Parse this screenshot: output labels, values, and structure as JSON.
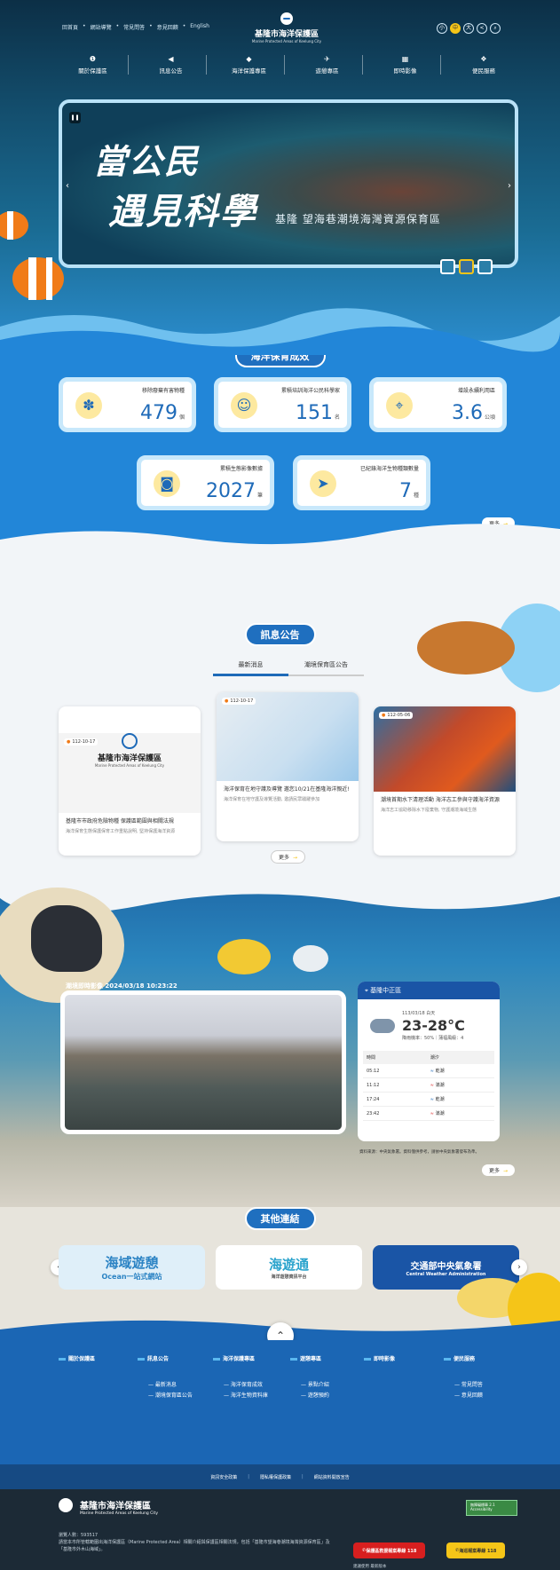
{
  "header": {
    "top_links": [
      "回首頁",
      "網站導覽",
      "常見問答",
      "意見回饋",
      "English"
    ],
    "logo_zh": "基隆市海洋保護區",
    "logo_en": "Marine Protected Areas of Keelung City",
    "util_icons": [
      "font-small-icon",
      "font-medium-icon",
      "font-large-icon",
      "share-icon",
      "search-icon"
    ],
    "util_glyphs": [
      "小",
      "中",
      "大",
      "<",
      "⌕"
    ],
    "nav": [
      "關於保護區",
      "訊息公告",
      "海洋保護專區",
      "遊憩專區",
      "即時影像",
      "便民服務"
    ],
    "nav_icons": [
      "info-icon",
      "megaphone-icon",
      "shield-icon",
      "boat-icon",
      "camera-icon",
      "service-icon"
    ],
    "nav_glyphs": [
      "❶",
      "◀",
      "◆",
      "✈",
      "▦",
      "❖"
    ]
  },
  "banner": {
    "line1": "當公民",
    "line2": "遇見科學",
    "tagline": "基隆 望海巷潮境海灣資源保育區"
  },
  "stats": {
    "title": "海洋保育成效",
    "items": [
      {
        "label": "移除廢棄有害物種",
        "value": "479",
        "unit": "個",
        "icon": "coral-icon"
      },
      {
        "label": "累積培訓海洋公民科學家",
        "value": "151",
        "unit": "名",
        "icon": "diver-icon"
      },
      {
        "label": "增設永續利用區",
        "value": "3.6",
        "unit": "公頃",
        "icon": "map-pin-icon"
      },
      {
        "label": "累積生態影像數據",
        "value": "2027",
        "unit": "筆",
        "icon": "camera-icon"
      },
      {
        "label": "已紀錄海洋生物種類數量",
        "value": "7",
        "unit": "種",
        "icon": "fish-icon"
      }
    ],
    "more": "更多"
  },
  "news": {
    "title": "訊息公告",
    "tabs": [
      "最新消息",
      "潮境保育區公告"
    ],
    "cards": [
      {
        "date": "112-10-17",
        "title": "基隆市市政府危險物種 保護區範圍與相關法規",
        "summary": "海洋保育生態保護保育工作重點說明, 堅持保護海洋資源",
        "img_text": "基隆市海洋保護區",
        "img_text_en": "Marine Protected Areas of Keelung City"
      },
      {
        "date": "112-10-17",
        "title": "海洋保育在地守護及導覽 邀您10/21在基隆海洋親近!",
        "summary": "海洋保育在地守護及導覽活動, 邀請民眾踴躍參加"
      },
      {
        "date": "112-05-06",
        "title": "潮境首期水下清理活動 海洋志工參與守護海洋資源",
        "summary": "海洋志工協助移除水下廢棄物, 守護潮境海域生態"
      }
    ],
    "more": "更多"
  },
  "cam": {
    "timestamp": "潮境即時影像 2024/03/18 10:23:22",
    "weather": {
      "location": "基隆中正區",
      "date": "113/03/18 白天",
      "temp": "23-28°C",
      "rain": "降雨機率：50%｜蒲福風級：4",
      "head": [
        "時間",
        "潮汐"
      ],
      "rows": [
        {
          "time": "05:12",
          "tide": "乾潮"
        },
        {
          "time": "11:12",
          "tide": "滿潮"
        },
        {
          "time": "17:24",
          "tide": "乾潮"
        },
        {
          "time": "23:42",
          "tide": "滿潮"
        }
      ],
      "source": "資料來源：中央氣象署。資料僅供參考，請依中央氣象署發布為準。"
    },
    "more": "更多"
  },
  "links": {
    "title": "其他連結",
    "items": [
      {
        "name": "海域遊憩 Ocean 一站式網站",
        "text1": "海域遊憩",
        "text2": "Ocean一站式網站"
      },
      {
        "name": "海遊通",
        "text1": "海遊通",
        "text2": "海洋遊憩資訊平台"
      },
      {
        "name": "交通部中央氣象署",
        "text1": "交通部中央氣象署",
        "text2": "Central Weather Administration"
      }
    ]
  },
  "footnav": {
    "cols": [
      {
        "h": "關於保護區",
        "s": []
      },
      {
        "h": "訊息公告",
        "s": [
          "最新消息",
          "潮境保育區公告"
        ]
      },
      {
        "h": "海洋保護專區",
        "s": [
          "海洋保育成效",
          "海洋生物資料庫"
        ]
      },
      {
        "h": "遊憩專區",
        "s": [
          "景點介紹",
          "遊憩預約"
        ]
      },
      {
        "h": "即時影像",
        "s": []
      },
      {
        "h": "便民服務",
        "s": [
          "常見問答",
          "意見回饋"
        ]
      }
    ]
  },
  "footer": {
    "links": [
      "資訊安全政策",
      "隱私權保護政策",
      "網站資料開放宣告"
    ],
    "logo_zh": "基隆市海洋保護區",
    "logo_en": "Marine Protected Areas of Keelung City",
    "visitors": "瀏覽人數：593517",
    "desc": "請當本市所管轄範圍出海洋保護區（Marine Protected Area）相關介紹與保護區相關法規，包括「基隆市望海巷潮境海灣資源保育區」及「基隆市外木山海域」。",
    "badge": "無障礙標章 2.1 Accessibility",
    "hot1": "保護區救援報案專線 118",
    "hot2": "海巡報案專線 118",
    "hot_note": "建議使用 最新版本"
  },
  "colors": {
    "primary": "#1e6ab8",
    "accent": "#f5c518",
    "hot1": "#d71f1f",
    "hot2": "#f5c518"
  }
}
